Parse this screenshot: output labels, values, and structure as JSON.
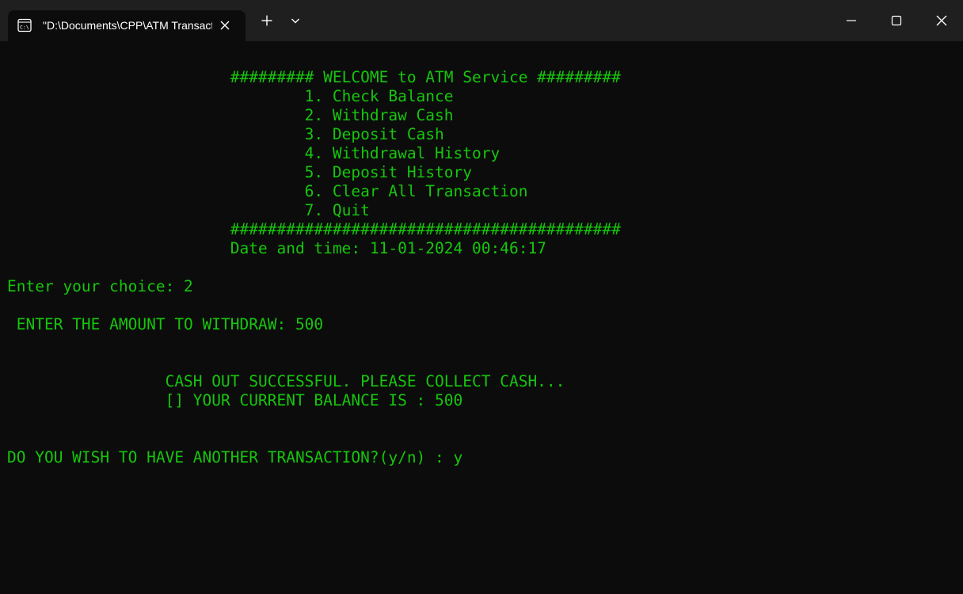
{
  "window": {
    "tab_title": "\"D:\\Documents\\CPP\\ATM Transaction.exe\"",
    "tab_icon": "console-icon"
  },
  "terminal": {
    "text_color": "#16c60c",
    "background_color": "#0c0c0c",
    "lines": [
      "                        ######### WELCOME to ATM Service #########",
      "                                1. Check Balance",
      "                                2. Withdraw Cash",
      "                                3. Deposit Cash",
      "                                4. Withdrawal History",
      "                                5. Deposit History",
      "                                6. Clear All Transaction",
      "                                7. Quit",
      "                        ##########################################",
      "                        Date and time: 11-01-2024 00:46:17",
      "",
      "Enter your choice: 2",
      "",
      " ENTER THE AMOUNT TO WITHDRAW: 500",
      "",
      "",
      "                 CASH OUT SUCCESSFUL. PLEASE COLLECT CASH...",
      "                 [] YOUR CURRENT BALANCE IS : 500",
      "",
      "",
      "DO YOU WISH TO HAVE ANOTHER TRANSACTION?(y/n) : y"
    ]
  }
}
